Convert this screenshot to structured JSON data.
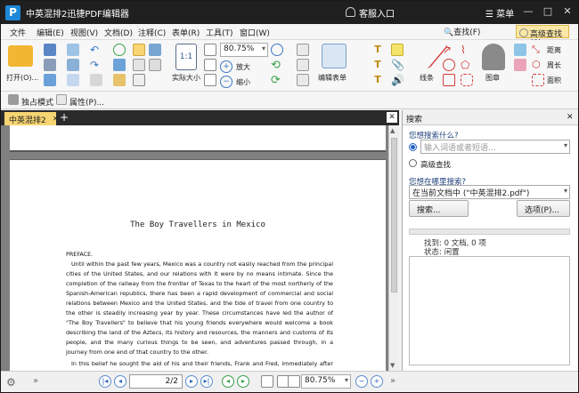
{
  "app": {
    "title": "中英混排2迅捷PDF编辑器",
    "service": "客服入口",
    "menu": "菜单"
  },
  "menubar": {
    "items": [
      "文件",
      "编辑(E)",
      "视图(V)",
      "文档(D)",
      "注释(C)",
      "表单(R)",
      "工具(T)",
      "窗口(W)"
    ],
    "find": "查找(F)",
    "advanced_find": "高级查找(S)"
  },
  "ribbon": {
    "open": "打开(O)...",
    "actual_size": "实际大小",
    "zoom": "80.75%",
    "zoom_in": "放大",
    "zoom_out": "缩小",
    "edit_form": "编辑表单",
    "lines": "线条",
    "stamp": "图章",
    "distance": "距离",
    "perimeter": "周长",
    "area": "面积"
  },
  "subbar": {
    "exclusive": "独占模式",
    "properties": "属性(P)..."
  },
  "tab": {
    "label": "中英混排2"
  },
  "document": {
    "title": "The Boy Travellers in Mexico",
    "preface": "PREFACE.",
    "para1": "Until within the past few years, Mexico was a country not easily reached from the principal cities of the United States, and our relations with it were by no means intimate. Since the completion of the railway from the frontier of Texas to the heart of the most northerly of the Spanish-American republics, there has been a rapid development of commercial and social relations between Mexico and the United States, and the tide of travel from one country to the other is steadily increasing year by year. These circumstances have led the author of \"The Boy Travellers\" to believe that his young friends everywhere would welcome a book describing the land of the Aztecs, its history and resources, the manners and customs of its people, and the many curious things to be seen, and adventures passed through, in a journey from one end of that country to the other.",
    "para2": "In this belief he sought the aid of his and their friends, Frank and Fred, immediately after their"
  },
  "statusbar": {
    "page": "2",
    "total": "2",
    "zoom": "80.75%"
  },
  "search": {
    "header": "搜索",
    "what_label": "您想搜索什么?",
    "input_placeholder": "输入词语或者短语...",
    "advanced": "高级查找",
    "where_label": "您想在哪里搜索?",
    "where_value": "在当前文档中 (\"中英混排2.pdf\")",
    "search_button": "搜索...",
    "options_button": "选项(P)...",
    "found": "找到: 0 文档, 0 项",
    "status": "状态: 闲置"
  }
}
